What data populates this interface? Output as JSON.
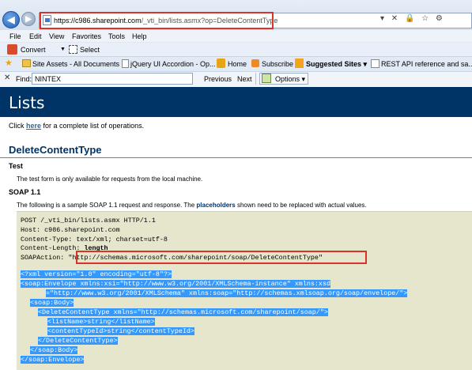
{
  "browser": {
    "url_host": "https://c986.sharepoint.com",
    "url_path": "/_vti_bin/lists.asmx?op=DeleteContentType",
    "address_tools": "▾ ✕ 🔒 ☆ ⚙"
  },
  "menu": [
    "File",
    "Edit",
    "View",
    "Favorites",
    "Tools",
    "Help"
  ],
  "commands": {
    "convert": "Convert",
    "select": "Select"
  },
  "favorites": [
    {
      "label": "Site Assets - All Documents"
    },
    {
      "label": "jQuery UI Accordion - Op..."
    },
    {
      "label": "Home"
    },
    {
      "label": "Subscribe"
    },
    {
      "label": "Suggested Sites ▾"
    },
    {
      "label": "REST API reference and sa..."
    }
  ],
  "find_bar": {
    "label": "Find:",
    "value": "NINTEX",
    "previous": "Previous",
    "next": "Next",
    "options": "Options ▾"
  },
  "page": {
    "title": "Lists",
    "intro_prefix": "Click ",
    "intro_link": "here",
    "intro_suffix": " for a complete list of operations.",
    "operation": "DeleteContentType",
    "test_heading": "Test",
    "test_text": "The test form is only available for requests from the local machine.",
    "soap_heading": "SOAP 1.1",
    "soap_text_prefix": "The following is a sample SOAP 1.1 request and response. The ",
    "soap_text_bold": "placeholders",
    "soap_text_suffix": " shown need to be replaced with actual values."
  },
  "code": {
    "request_line": "POST /_vti_bin/lists.asmx HTTP/1.1",
    "host": "Host: c986.sharepoint.com",
    "content_type": "Content-Type: text/xml; charset=utf-8",
    "content_length_prefix": "Content-Length: ",
    "content_length_value": "length",
    "soap_action_prefix": "SOAPAction: ",
    "soap_action_value": "\"http://schemas.microsoft.com/sharepoint/soap/DeleteContentType\"",
    "xml_lines": [
      "<?xml version=\"1.0\" encoding=\"utf-8\"?>",
      "<soap:Envelope xmlns:xsi=\"http://www.w3.org/2001/XMLSchema-instance\" xmlns:xsd",
      "=\"http://www.w3.org/2001/XMLSchema\" xmlns:soap=\"http://schemas.xmlsoap.org/soap/envelope/\">",
      "<soap:Body>",
      "<DeleteContentType xmlns=\"http://schemas.microsoft.com/sharepoint/soap/\">",
      "<listName>string</listName>",
      "<contentTypeId>string</contentTypeId>",
      "</DeleteContentType>",
      "</soap:Body>",
      "</soap:Envelope>"
    ]
  },
  "colors": {
    "banner": "#003366",
    "selection": "#3399ff",
    "code_background": "#e6e6cc",
    "callout": "#d9342b"
  }
}
